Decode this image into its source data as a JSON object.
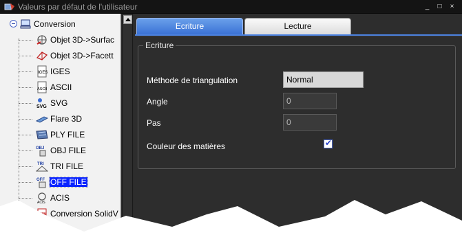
{
  "window": {
    "title": "Valeurs par défaut de l'utilisateur",
    "buttons": [
      "_",
      "□",
      "×"
    ]
  },
  "tree": {
    "root": {
      "label": "Conversion",
      "icon": "computer-icon",
      "expanded": true
    },
    "items": [
      {
        "label": "Objet 3D->Surfac",
        "icon": "surface-object-icon"
      },
      {
        "label": "Objet 3D->Facett",
        "icon": "facet-object-icon"
      },
      {
        "label": "IGES",
        "icon": "iges-file-icon"
      },
      {
        "label": "ASCII",
        "icon": "ascii-file-icon"
      },
      {
        "label": "SVG",
        "icon": "svg-file-icon"
      },
      {
        "label": "Flare 3D",
        "icon": "flare3d-icon"
      },
      {
        "label": "PLY FILE",
        "icon": "ply-file-icon"
      },
      {
        "label": "OBJ FILE",
        "icon": "obj-file-icon"
      },
      {
        "label": "TRI FILE",
        "icon": "tri-file-icon"
      },
      {
        "label": "OFF FILE",
        "icon": "off-file-icon",
        "selected": true
      },
      {
        "label": "ACIS",
        "icon": "acis-icon"
      },
      {
        "label": "Conversion SolidV",
        "icon": "solidworks-icon"
      }
    ]
  },
  "tabs": [
    {
      "label": "Ecriture",
      "active": true
    },
    {
      "label": "Lecture",
      "active": false
    }
  ],
  "group": {
    "legend": "Ecriture",
    "fields": {
      "triangulation_label": "Méthode de triangulation",
      "triangulation_value": "Normal",
      "angle_label": "Angle",
      "angle_value": "0",
      "pas_label": "Pas",
      "pas_value": "0",
      "couleur_label": "Couleur des matières",
      "couleur_checked": true
    }
  },
  "colors": {
    "tab_active": "#3b72d6",
    "selection": "#0a24ff",
    "background": "#2d2d2d"
  }
}
